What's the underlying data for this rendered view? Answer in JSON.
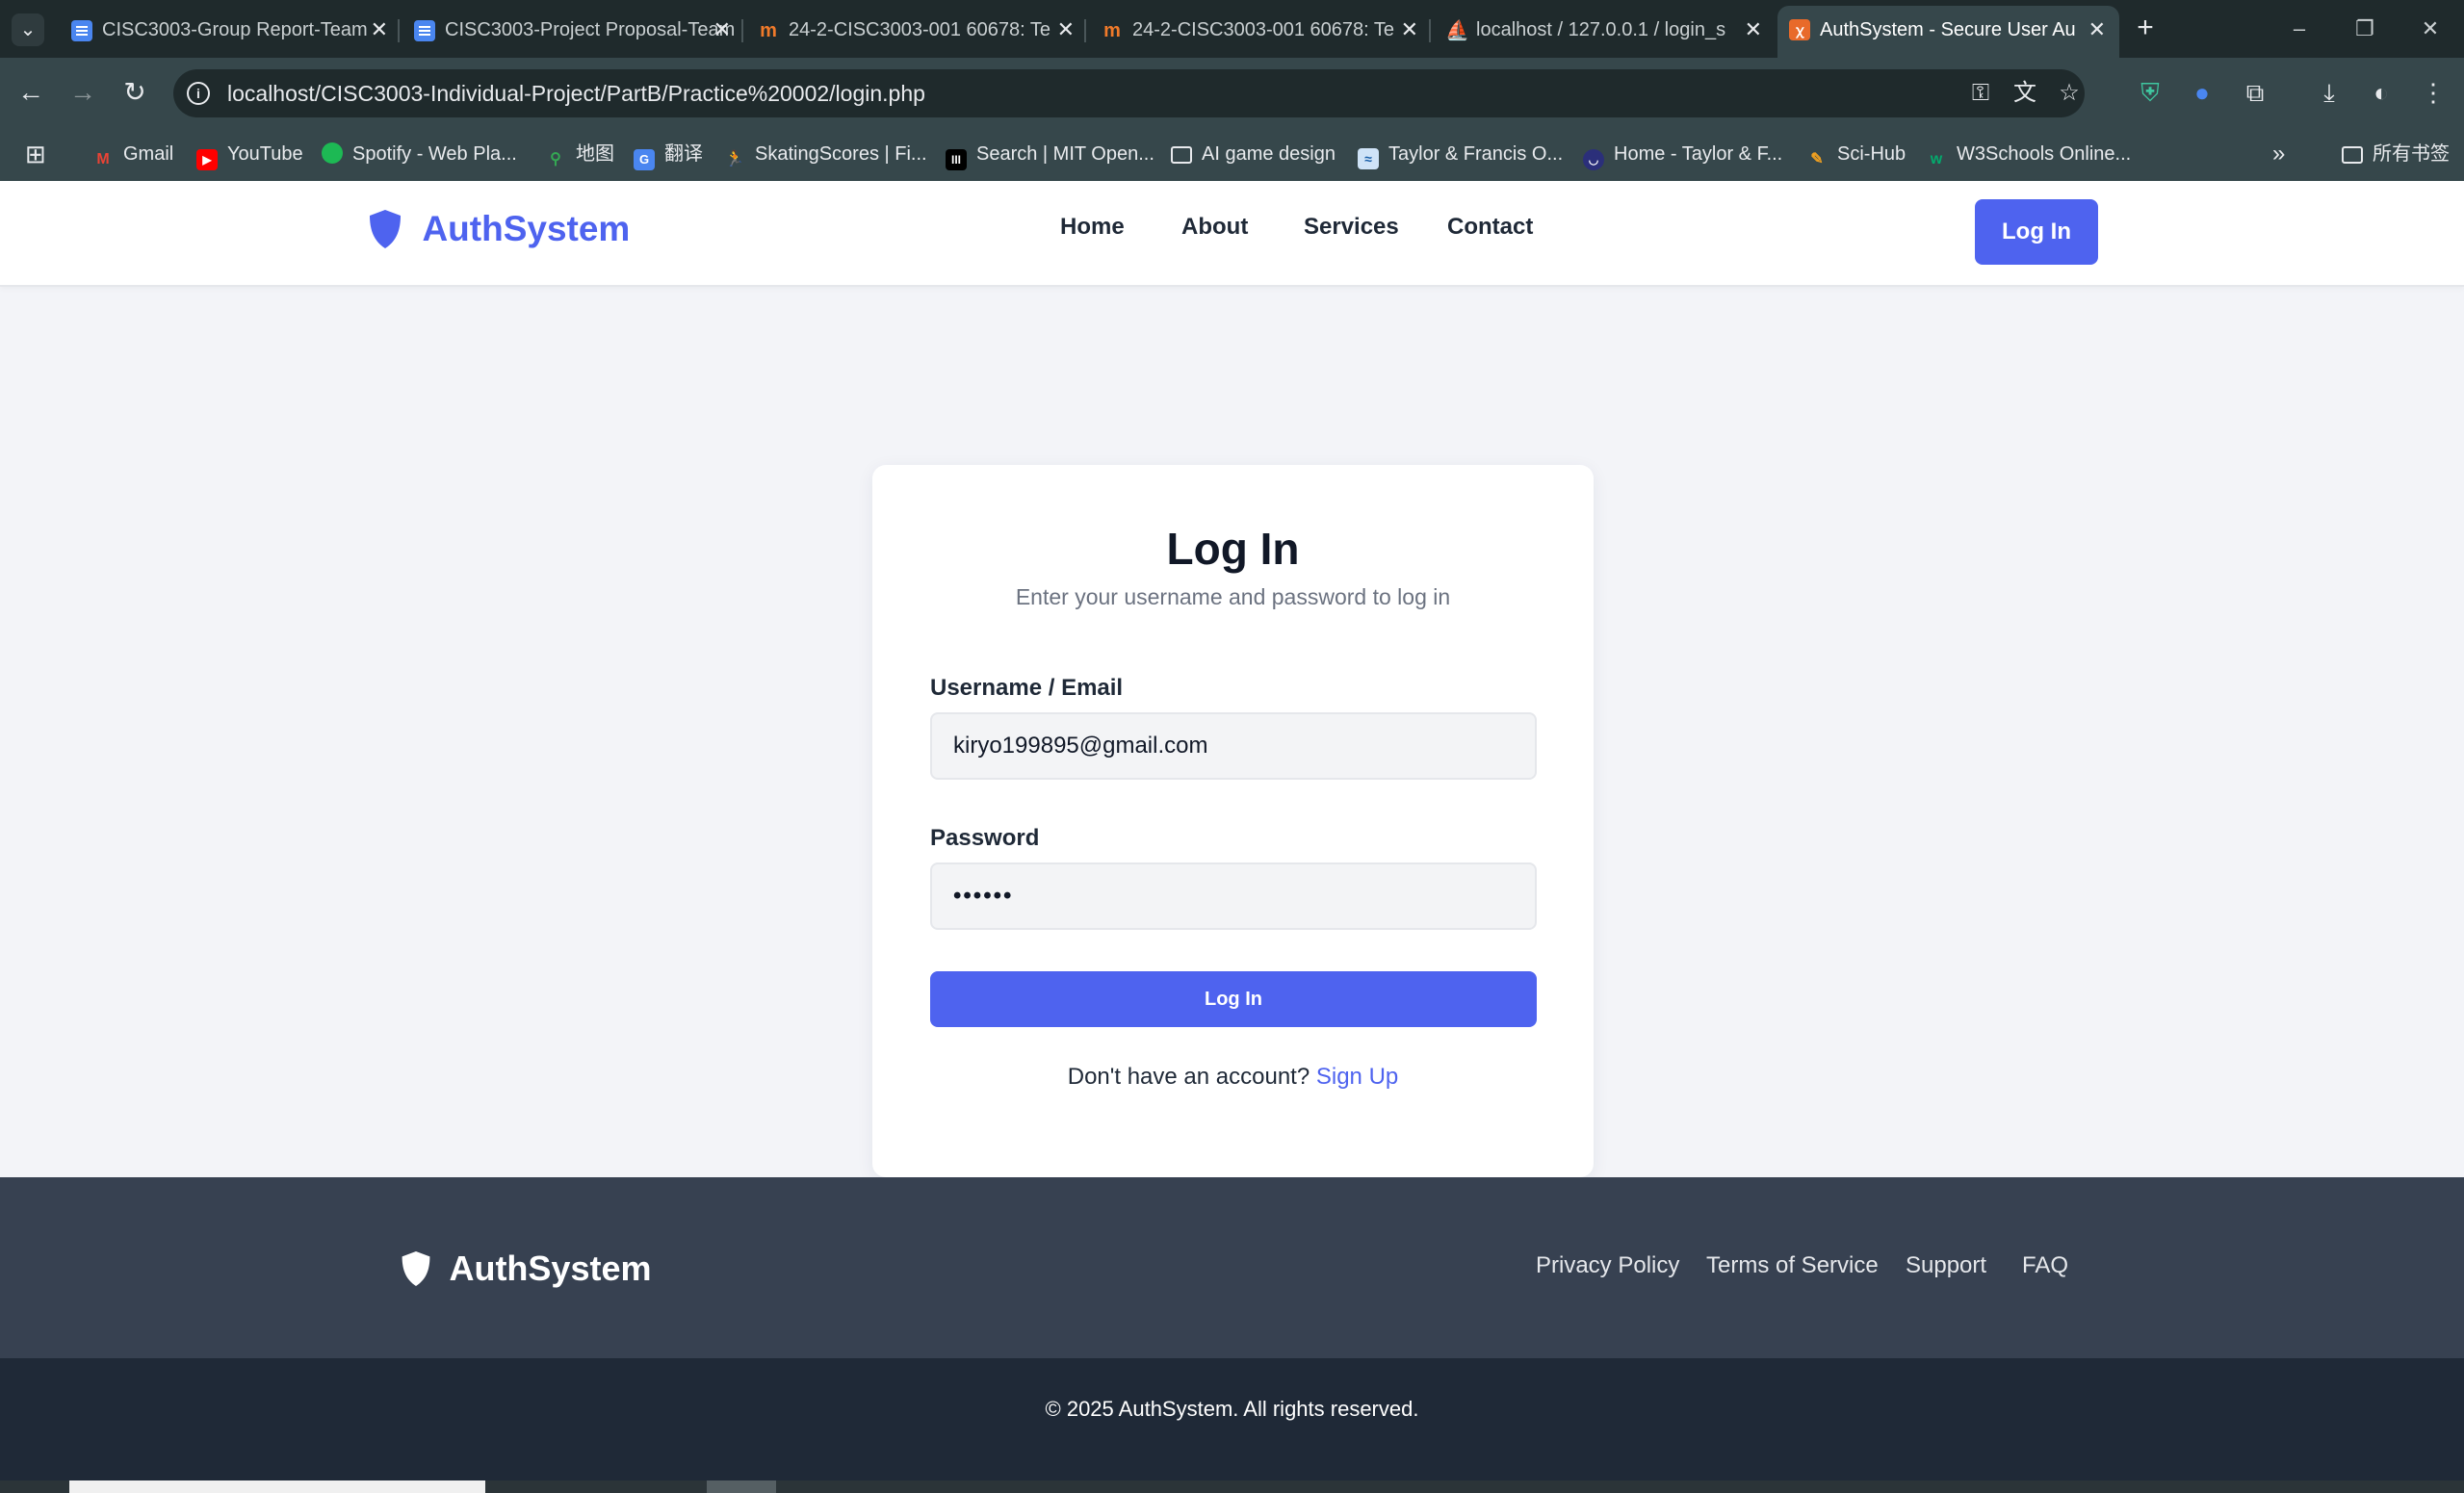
{
  "browser": {
    "tabs": [
      {
        "title": "CISC3003-Group Report-Team",
        "favicon": "docs-icon"
      },
      {
        "title": "CISC3003-Project Proposal-Team",
        "favicon": "docs-icon"
      },
      {
        "title": "24-2-CISC3003-001 60678: Te",
        "favicon": "moodle-icon"
      },
      {
        "title": "24-2-CISC3003-001 60678: Te",
        "favicon": "moodle-icon"
      },
      {
        "title": "localhost / 127.0.0.1 / login_s",
        "favicon": "phpmyadmin-icon"
      },
      {
        "title": "AuthSystem - Secure User Au",
        "favicon": "xampp-icon"
      }
    ],
    "url": "localhost/CISC3003-Individual-Project/PartB/Practice%20002/login.php",
    "bookmarks": [
      "Gmail",
      "YouTube",
      "Spotify - Web Pla...",
      "地图",
      "翻译",
      "SkatingScores | Fi...",
      "Search | MIT Open...",
      "AI game design",
      "Taylor & Francis O...",
      "Home - Taylor & F...",
      "Sci-Hub",
      "W3Schools Online...",
      "所有书签"
    ]
  },
  "site": {
    "brand": "AuthSystem",
    "brand_color": "#4e63ef",
    "nav": [
      "Home",
      "About",
      "Services",
      "Contact"
    ],
    "header_login": "Log In"
  },
  "login": {
    "title": "Log In",
    "subtitle": "Enter your username and password to log in",
    "username_label": "Username / Email",
    "username_value": "kiryo199895@gmail.com",
    "password_label": "Password",
    "password_value": "••••••",
    "submit": "Log In",
    "signup_prompt": "Don't have an account?",
    "signup_link": "Sign Up"
  },
  "footer": {
    "brand": "AuthSystem",
    "links": [
      "Privacy Policy",
      "Terms of Service",
      "Support",
      "FAQ"
    ],
    "copyright": "© 2025 AuthSystem. All rights reserved."
  }
}
